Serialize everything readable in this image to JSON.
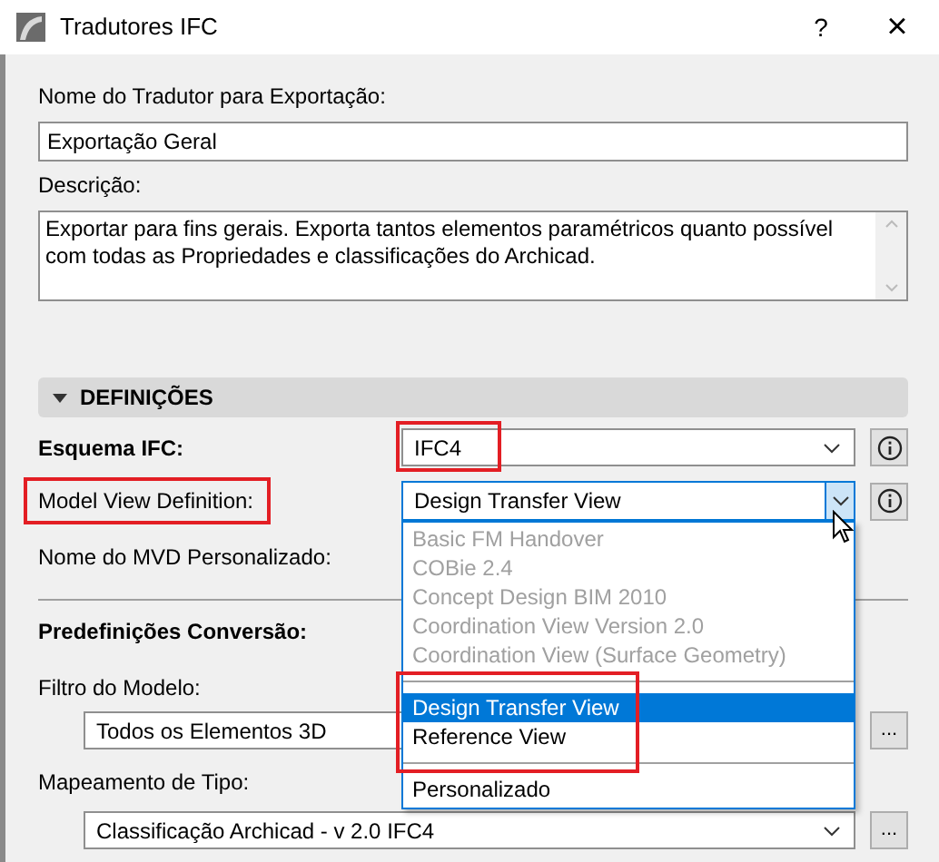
{
  "window": {
    "title": "Tradutores IFC",
    "help": "?",
    "close": "×"
  },
  "name_field": {
    "label": "Nome do Tradutor para Exportação:",
    "value": "Exportação Geral"
  },
  "description_field": {
    "label": "Descrição:",
    "value": "Exportar para fins gerais. Exporta tantos elementos paramétricos quanto possível com todas as Propriedades e classificações do Archicad."
  },
  "section": {
    "title": "DEFINIÇÕES",
    "expanded": true
  },
  "schema": {
    "label": "Esquema IFC:",
    "value": "IFC4",
    "highlighted": true
  },
  "mvd": {
    "label": "Model View Definition:",
    "value": "Design Transfer View",
    "label_highlighted": true,
    "open": true
  },
  "custom_mvd": {
    "label": "Nome do MVD Personalizado:"
  },
  "presets": {
    "title": "Predefinições Conversão:"
  },
  "model_filter": {
    "label": "Filtro do Modelo:",
    "value": "Todos os Elementos 3D",
    "button": "..."
  },
  "type_mapping": {
    "label": "Mapeamento de Tipo:",
    "value": "Classificação Archicad - v 2.0 IFC4",
    "button": "..."
  },
  "dropdown_options": [
    {
      "kind": "option",
      "label": "Basic FM Handover",
      "disabled": true,
      "selected": false,
      "highlighted": false
    },
    {
      "kind": "option",
      "label": "COBie 2.4",
      "disabled": true,
      "selected": false,
      "highlighted": false
    },
    {
      "kind": "option",
      "label": "Concept Design BIM 2010",
      "disabled": true,
      "selected": false,
      "highlighted": false
    },
    {
      "kind": "option",
      "label": "Coordination View Version 2.0",
      "disabled": true,
      "selected": false,
      "highlighted": false
    },
    {
      "kind": "option",
      "label": "Coordination View (Surface Geometry)",
      "disabled": true,
      "selected": false,
      "highlighted": false
    },
    {
      "kind": "separator"
    },
    {
      "kind": "option",
      "label": "Design Transfer View",
      "disabled": false,
      "selected": true,
      "highlighted": true
    },
    {
      "kind": "option",
      "label": "Reference View",
      "disabled": false,
      "selected": false,
      "highlighted": true
    },
    {
      "kind": "separator"
    },
    {
      "kind": "option",
      "label": "Personalizado",
      "disabled": false,
      "selected": false,
      "highlighted": false
    }
  ]
}
